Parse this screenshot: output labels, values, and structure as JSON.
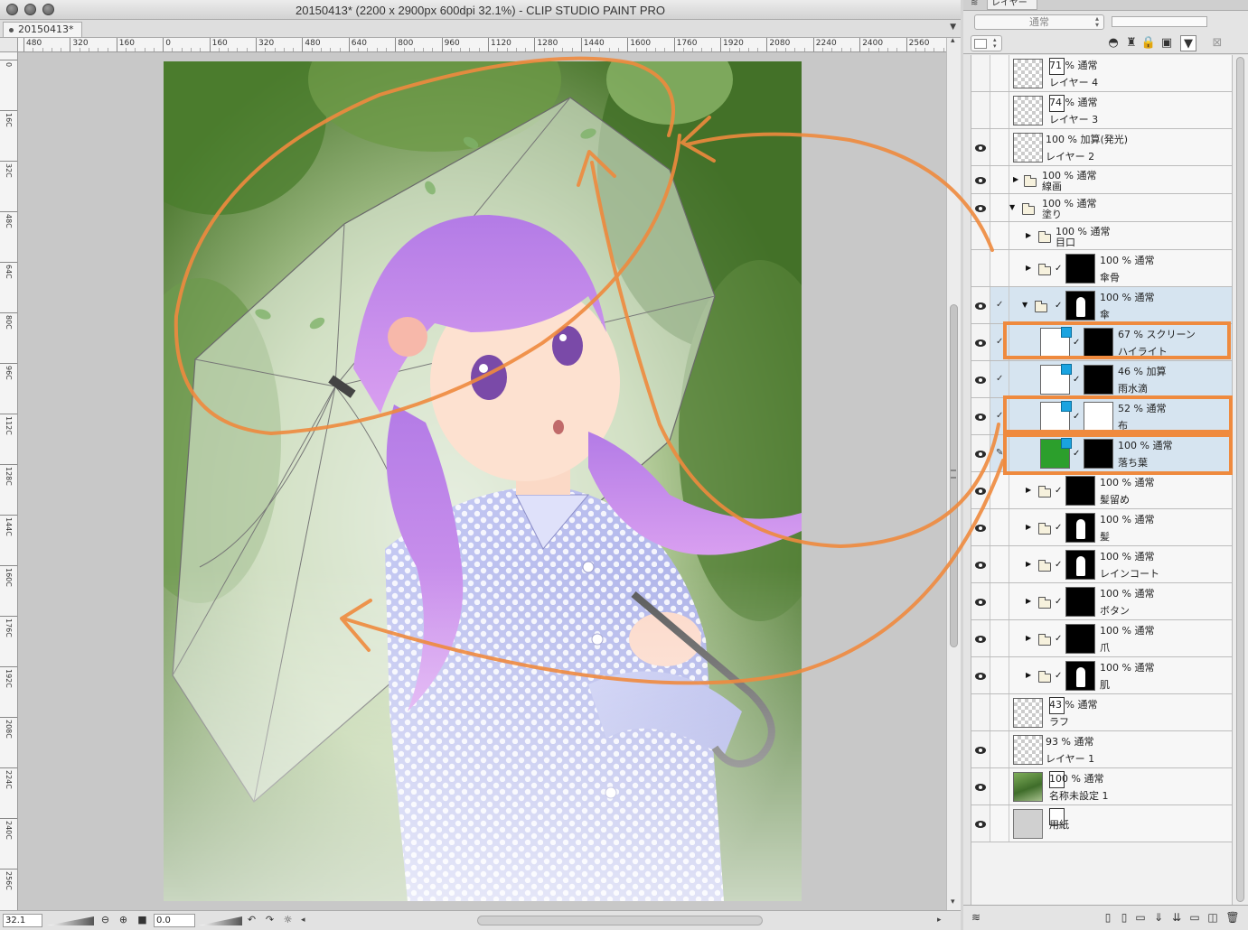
{
  "window": {
    "title": "20150413* (2200 x 2900px 600dpi 32.1%)  - CLIP STUDIO PAINT PRO",
    "doc_tab": "20150413*"
  },
  "ruler": {
    "h_labels": [
      "480",
      "320",
      "160",
      "0",
      "160",
      "320",
      "480",
      "640",
      "800",
      "960",
      "1120",
      "1280",
      "1440",
      "1600",
      "1760",
      "1920",
      "2080",
      "2240",
      "2400",
      "2560"
    ],
    "v_labels": [
      "0",
      "16C",
      "32C",
      "48C",
      "64C",
      "80C",
      "96C",
      "112C",
      "128C",
      "144C",
      "160C",
      "176C",
      "192C",
      "208C",
      "224C",
      "240C",
      "256C"
    ]
  },
  "statusbar": {
    "zoom": "32.1",
    "rotation": "0.0"
  },
  "layer_panel": {
    "tab_label": "レイヤー",
    "blend_mode": "通常",
    "layers": [
      {
        "mode": "71 % 通常",
        "name": "レイヤー 4"
      },
      {
        "mode": "74 % 通常",
        "name": "レイヤー 3"
      },
      {
        "mode": "100 % 加算(発光)",
        "name": "レイヤー 2"
      },
      {
        "mode": "100 % 通常",
        "name": "線画"
      },
      {
        "mode": "100 % 通常",
        "name": "塗り"
      },
      {
        "mode": "100 % 通常",
        "name": "目口"
      },
      {
        "mode": "100 % 通常",
        "name": "傘骨"
      },
      {
        "mode": "100 % 通常",
        "name": "傘"
      },
      {
        "mode": "67 % スクリーン",
        "name": "ハイライト"
      },
      {
        "mode": "46 % 加算",
        "name": "雨水滴"
      },
      {
        "mode": "52 % 通常",
        "name": "布"
      },
      {
        "mode": "100 % 通常",
        "name": "落ち葉"
      },
      {
        "mode": "100 % 通常",
        "name": "髪留め"
      },
      {
        "mode": "100 % 通常",
        "name": "髪"
      },
      {
        "mode": "100 % 通常",
        "name": "レインコート"
      },
      {
        "mode": "100 % 通常",
        "name": "ボタン"
      },
      {
        "mode": "100 % 通常",
        "name": "爪"
      },
      {
        "mode": "100 % 通常",
        "name": "肌"
      },
      {
        "mode": "43 % 通常",
        "name": "ラフ"
      },
      {
        "mode": "93 % 通常",
        "name": "レイヤー 1"
      },
      {
        "mode": "100 % 通常",
        "name": "名称未設定 1"
      },
      {
        "mode": "",
        "name": "用紙"
      }
    ]
  },
  "colors": {
    "annotation_orange": "#ef8a3e",
    "selected_row": "#d6e4f0",
    "leaf_green": "#2c9f2c"
  },
  "icons": [
    "eye-icon",
    "folder-icon",
    "lock-icon",
    "layer-mask-icon",
    "new-layer-icon",
    "new-folder-icon",
    "merge-down-icon",
    "delete-icon",
    "zoom-in-icon",
    "zoom-out-icon",
    "rotate-left-icon",
    "rotate-right-icon",
    "reset-icon"
  ]
}
